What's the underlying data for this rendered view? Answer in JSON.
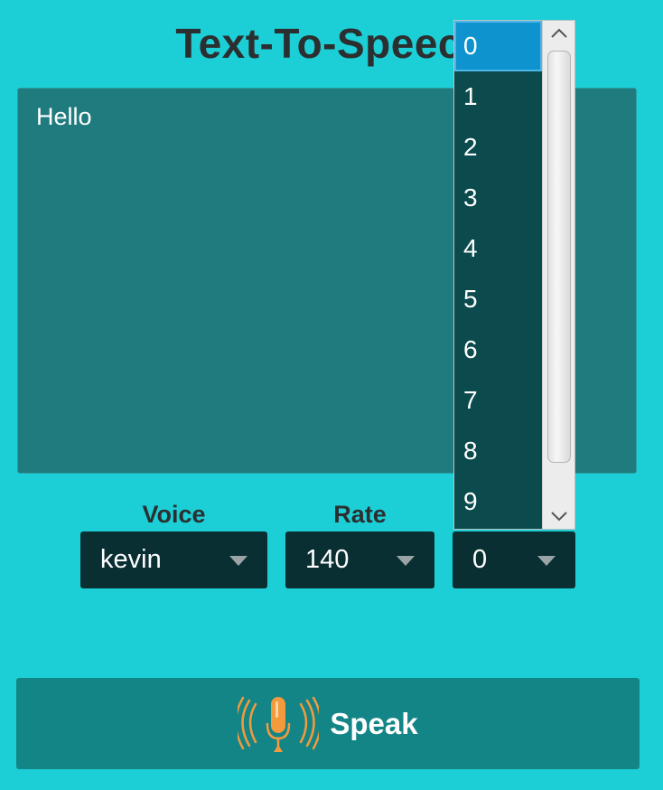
{
  "app": {
    "title": "Text-To-Speech"
  },
  "text_area": {
    "value": "Hello"
  },
  "labels": {
    "voice": "Voice",
    "rate": "Rate"
  },
  "combos": {
    "voice": "kevin",
    "rate": "140",
    "third": "0"
  },
  "popup": {
    "items": [
      "0",
      "1",
      "2",
      "3",
      "4",
      "5",
      "6",
      "7",
      "8",
      "9"
    ],
    "selected": "0"
  },
  "speak_button": {
    "label": "Speak",
    "icon": "microphone-icon"
  },
  "colors": {
    "background": "#1ccfd6",
    "text_area": "#1f7b7d",
    "combo": "#0a2f33",
    "speak_button": "#138587",
    "popup": "#0b4a4d",
    "popup_selected": "#0f93cf",
    "mic_icon": "#f39a3d"
  }
}
